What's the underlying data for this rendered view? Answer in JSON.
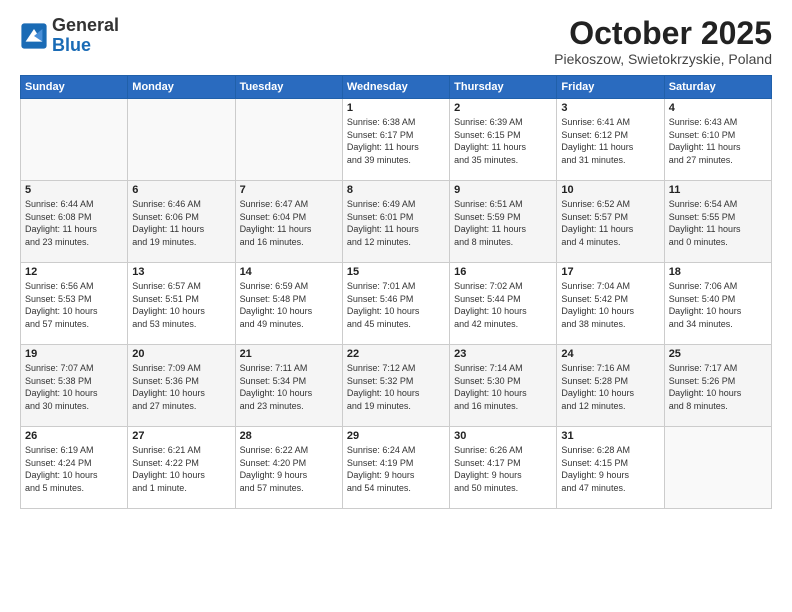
{
  "header": {
    "logo": {
      "general": "General",
      "blue": "Blue"
    },
    "title": "October 2025",
    "subtitle": "Piekoszow, Swietokrzyskie, Poland"
  },
  "weekdays": [
    "Sunday",
    "Monday",
    "Tuesday",
    "Wednesday",
    "Thursday",
    "Friday",
    "Saturday"
  ],
  "weeks": [
    [
      {
        "day": "",
        "info": ""
      },
      {
        "day": "",
        "info": ""
      },
      {
        "day": "",
        "info": ""
      },
      {
        "day": "1",
        "info": "Sunrise: 6:38 AM\nSunset: 6:17 PM\nDaylight: 11 hours\nand 39 minutes."
      },
      {
        "day": "2",
        "info": "Sunrise: 6:39 AM\nSunset: 6:15 PM\nDaylight: 11 hours\nand 35 minutes."
      },
      {
        "day": "3",
        "info": "Sunrise: 6:41 AM\nSunset: 6:12 PM\nDaylight: 11 hours\nand 31 minutes."
      },
      {
        "day": "4",
        "info": "Sunrise: 6:43 AM\nSunset: 6:10 PM\nDaylight: 11 hours\nand 27 minutes."
      }
    ],
    [
      {
        "day": "5",
        "info": "Sunrise: 6:44 AM\nSunset: 6:08 PM\nDaylight: 11 hours\nand 23 minutes."
      },
      {
        "day": "6",
        "info": "Sunrise: 6:46 AM\nSunset: 6:06 PM\nDaylight: 11 hours\nand 19 minutes."
      },
      {
        "day": "7",
        "info": "Sunrise: 6:47 AM\nSunset: 6:04 PM\nDaylight: 11 hours\nand 16 minutes."
      },
      {
        "day": "8",
        "info": "Sunrise: 6:49 AM\nSunset: 6:01 PM\nDaylight: 11 hours\nand 12 minutes."
      },
      {
        "day": "9",
        "info": "Sunrise: 6:51 AM\nSunset: 5:59 PM\nDaylight: 11 hours\nand 8 minutes."
      },
      {
        "day": "10",
        "info": "Sunrise: 6:52 AM\nSunset: 5:57 PM\nDaylight: 11 hours\nand 4 minutes."
      },
      {
        "day": "11",
        "info": "Sunrise: 6:54 AM\nSunset: 5:55 PM\nDaylight: 11 hours\nand 0 minutes."
      }
    ],
    [
      {
        "day": "12",
        "info": "Sunrise: 6:56 AM\nSunset: 5:53 PM\nDaylight: 10 hours\nand 57 minutes."
      },
      {
        "day": "13",
        "info": "Sunrise: 6:57 AM\nSunset: 5:51 PM\nDaylight: 10 hours\nand 53 minutes."
      },
      {
        "day": "14",
        "info": "Sunrise: 6:59 AM\nSunset: 5:48 PM\nDaylight: 10 hours\nand 49 minutes."
      },
      {
        "day": "15",
        "info": "Sunrise: 7:01 AM\nSunset: 5:46 PM\nDaylight: 10 hours\nand 45 minutes."
      },
      {
        "day": "16",
        "info": "Sunrise: 7:02 AM\nSunset: 5:44 PM\nDaylight: 10 hours\nand 42 minutes."
      },
      {
        "day": "17",
        "info": "Sunrise: 7:04 AM\nSunset: 5:42 PM\nDaylight: 10 hours\nand 38 minutes."
      },
      {
        "day": "18",
        "info": "Sunrise: 7:06 AM\nSunset: 5:40 PM\nDaylight: 10 hours\nand 34 minutes."
      }
    ],
    [
      {
        "day": "19",
        "info": "Sunrise: 7:07 AM\nSunset: 5:38 PM\nDaylight: 10 hours\nand 30 minutes."
      },
      {
        "day": "20",
        "info": "Sunrise: 7:09 AM\nSunset: 5:36 PM\nDaylight: 10 hours\nand 27 minutes."
      },
      {
        "day": "21",
        "info": "Sunrise: 7:11 AM\nSunset: 5:34 PM\nDaylight: 10 hours\nand 23 minutes."
      },
      {
        "day": "22",
        "info": "Sunrise: 7:12 AM\nSunset: 5:32 PM\nDaylight: 10 hours\nand 19 minutes."
      },
      {
        "day": "23",
        "info": "Sunrise: 7:14 AM\nSunset: 5:30 PM\nDaylight: 10 hours\nand 16 minutes."
      },
      {
        "day": "24",
        "info": "Sunrise: 7:16 AM\nSunset: 5:28 PM\nDaylight: 10 hours\nand 12 minutes."
      },
      {
        "day": "25",
        "info": "Sunrise: 7:17 AM\nSunset: 5:26 PM\nDaylight: 10 hours\nand 8 minutes."
      }
    ],
    [
      {
        "day": "26",
        "info": "Sunrise: 6:19 AM\nSunset: 4:24 PM\nDaylight: 10 hours\nand 5 minutes."
      },
      {
        "day": "27",
        "info": "Sunrise: 6:21 AM\nSunset: 4:22 PM\nDaylight: 10 hours\nand 1 minute."
      },
      {
        "day": "28",
        "info": "Sunrise: 6:22 AM\nSunset: 4:20 PM\nDaylight: 9 hours\nand 57 minutes."
      },
      {
        "day": "29",
        "info": "Sunrise: 6:24 AM\nSunset: 4:19 PM\nDaylight: 9 hours\nand 54 minutes."
      },
      {
        "day": "30",
        "info": "Sunrise: 6:26 AM\nSunset: 4:17 PM\nDaylight: 9 hours\nand 50 minutes."
      },
      {
        "day": "31",
        "info": "Sunrise: 6:28 AM\nSunset: 4:15 PM\nDaylight: 9 hours\nand 47 minutes."
      },
      {
        "day": "",
        "info": ""
      }
    ]
  ]
}
